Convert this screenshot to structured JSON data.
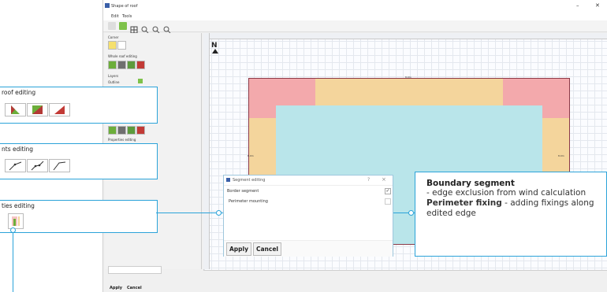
{
  "window": {
    "title": "Shape of roof",
    "menu": [
      "Edit",
      "Tools"
    ],
    "controls": [
      "–"
    ]
  },
  "toolbar": {
    "icons": [
      "pointer-icon",
      "select-icon",
      "grid-icon",
      "zoom-fit-icon",
      "zoom-in-icon",
      "zoom-out-icon"
    ]
  },
  "left_panel": {
    "sections": [
      "Corner",
      "Whole roof editing",
      "Layers",
      "Properties editing"
    ],
    "layer_row_label": "Outline"
  },
  "canvas": {
    "north_label": "N",
    "edge_labels": [
      "8.0m",
      "8.0m",
      "8.0m"
    ]
  },
  "callouts": {
    "roof_editing": "roof editing",
    "segments_editing": "nts editing",
    "properties_editing": "ties editing"
  },
  "dialog": {
    "title": "Segment editing",
    "rows": [
      {
        "label": "Border segment",
        "checked": true
      },
      {
        "label": "Perimeter mounting",
        "checked": false
      }
    ],
    "apply": "Apply",
    "cancel": "Cancel",
    "help": "?",
    "close": "×"
  },
  "info": {
    "heading": "Boundary segment",
    "heading_desc": " - edge exclusion from wind calculation",
    "fixing_title": "Perimeter fixing",
    "fixing_desc": " - adding fixings along edited edge"
  },
  "bottom": {
    "apply": "Apply",
    "cancel": "Cancel"
  },
  "colors": {
    "accent": "#2ba3d9",
    "roof_pink": "#f3a9ac",
    "roof_yellow": "#f4d59c",
    "roof_cyan": "#b9e5ea",
    "roof_outline": "#8b3a48"
  }
}
